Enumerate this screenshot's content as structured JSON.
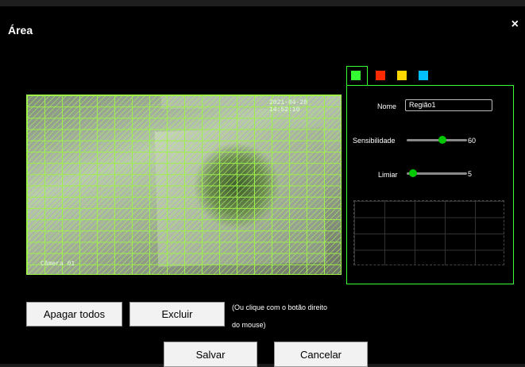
{
  "dialog": {
    "title": "Área",
    "close_label": "×"
  },
  "video": {
    "timestamp": "2021-04-28 14:52:10",
    "channel": "Câmera 01"
  },
  "colors": {
    "region1": "#33ff33",
    "region2": "#ff2a00",
    "region3": "#ffd700",
    "region4": "#00bfff"
  },
  "panel": {
    "name_label": "Nome",
    "name_value": "Região1",
    "sensitivity_label": "Sensibilidade",
    "sensitivity_value": "60",
    "sensitivity_level": 0.6,
    "threshold_label": "Limiar",
    "threshold_value": "5",
    "threshold_level": 0.05
  },
  "actions": {
    "clear_all": "Apagar todos",
    "delete": "Excluir",
    "hint_line1": "(Ou clique com o botão direito",
    "hint_line2": "do mouse)",
    "save": "Salvar",
    "cancel": "Cancelar"
  }
}
